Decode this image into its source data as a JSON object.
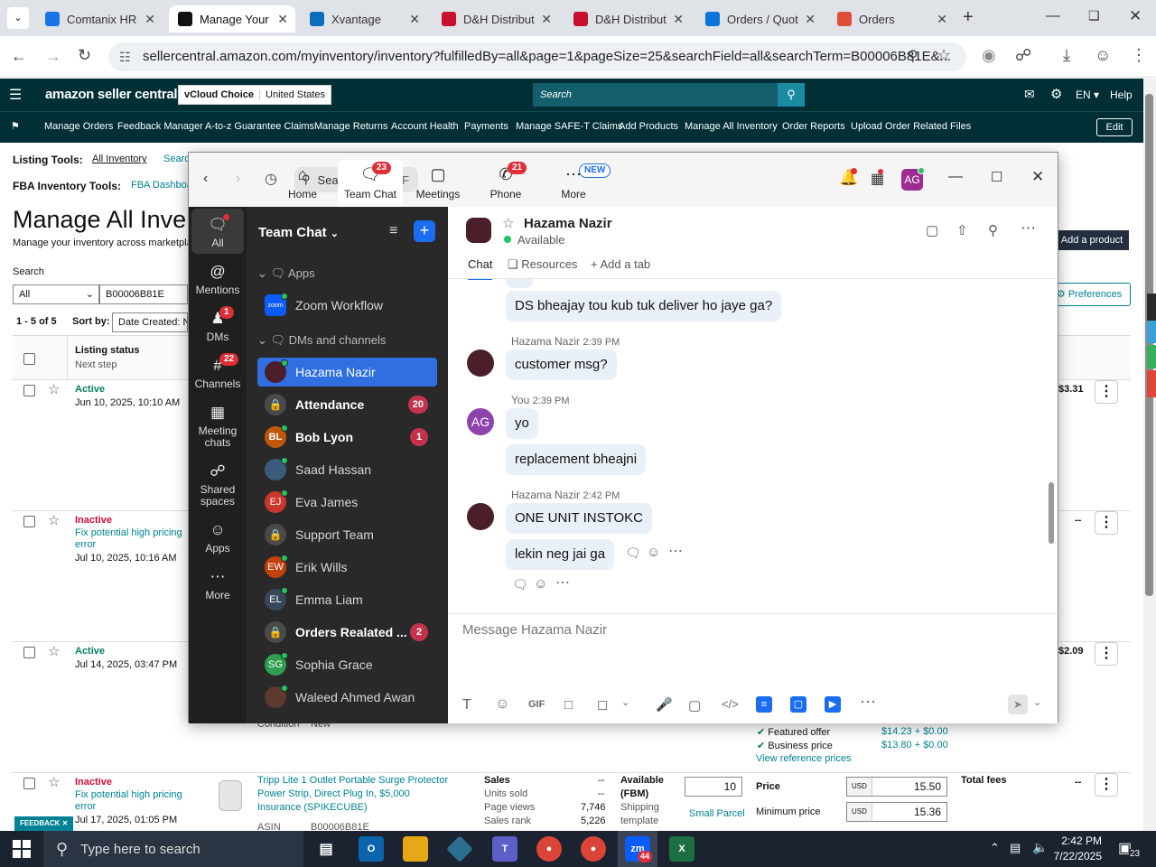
{
  "browser": {
    "tabs": [
      {
        "label": "Comtanix HR",
        "icon": "globe-icon",
        "color": "#1a73e8"
      },
      {
        "label": "Manage Your",
        "icon": "amazon-icon",
        "color": "#111111"
      },
      {
        "label": "Xvantage",
        "icon": "xvantage-icon",
        "color": "#0a6ebd"
      },
      {
        "label": "D&H Distribut",
        "icon": "dh-icon",
        "color": "#c8102e"
      },
      {
        "label": "D&H Distribut",
        "icon": "dh-icon",
        "color": "#c8102e"
      },
      {
        "label": "Orders / Quot",
        "icon": "ec-icon",
        "color": "#0a74da"
      },
      {
        "label": "Orders",
        "icon": "orders-icon",
        "color": "#e04e39"
      }
    ],
    "url": "sellercentral.amazon.com/myinventory/inventory?fulfilledBy=all&page=1&pageSize=25&searchField=all&searchTerm=B00006B81E&..."
  },
  "amazon": {
    "logo": "amazon seller central",
    "store": "vCloud Choice",
    "region": "United States",
    "search_placeholder": "Search",
    "lang": "EN",
    "help": "Help",
    "nav": [
      "Manage Orders",
      "Feedback Manager",
      "A-to-z Guarantee Claims",
      "Manage Returns",
      "Account Health",
      "Payments",
      "Manage SAFE-T Claims",
      "Add Products",
      "Manage All Inventory",
      "Order Reports",
      "Upload Order Related Files"
    ],
    "edit": "Edit",
    "listing_tools_label": "Listing Tools:",
    "all_inventory": "All Inventory",
    "searc": "Searc",
    "fba_label": "FBA Inventory Tools:",
    "fba_link": "FBA Dashboa",
    "page_title": "Manage All Inve",
    "subtitle": "Manage your inventory across marketpla",
    "search_label": "Search",
    "filter_all": "All",
    "search_value": "B00006B81E",
    "results": "1 - 5 of 5",
    "sort_by": "Sort by:",
    "sort_value": "Date Created: Ne",
    "add_product": "Add a product",
    "preferences": "Preferences",
    "col_status": "Listing status",
    "col_next": "Next step",
    "rows": [
      {
        "status": "Active",
        "kind": "active",
        "date": "Jun 10, 2025, 10:10 AM",
        "price": "$3.31"
      },
      {
        "status": "Inactive",
        "kind": "inactive",
        "fix": "Fix potential high pricing error",
        "date": "Jul 10, 2025, 10:16 AM",
        "price": "--"
      },
      {
        "status": "Active",
        "kind": "active",
        "date": "Jul 14, 2025, 03:47 PM",
        "price": "$2.09"
      },
      {
        "status": "Inactive",
        "kind": "inactive",
        "fix": "Fix potential high pricing error",
        "date": "Jul 17, 2025, 01:05 PM",
        "price": "--"
      }
    ],
    "row3_bottom": {
      "condition": "Condition",
      "condition_val": "New",
      "featured": "Featured offer",
      "featured_val": "$14.23 + $0.00",
      "business": "Business price",
      "business_val": "$13.80 + $0.00",
      "view_ref": "View reference prices"
    },
    "row4": {
      "title": "Tripp Lite 1 Outlet Portable Surge Protector Power Strip, Direct Plug In, $5,000 Insurance (SPIKECUBE)",
      "asin_label": "ASIN",
      "asin": "B00006B81E",
      "sales": "Sales",
      "units_sold": "Units sold",
      "units_val": "--",
      "page_views": "Page views",
      "page_views_val": "7,746",
      "sales_rank": "Sales rank",
      "sales_rank_val": "5,226",
      "sales_dash": "--",
      "available": "Available",
      "fbm": "(FBM)",
      "shipping": "Shipping",
      "template": "template",
      "qty": "10",
      "small_parcel": "Small Parcel",
      "price_label": "Price",
      "min_price_label": "Minimum price",
      "currency": "USD",
      "price": "15.50",
      "min_price": "15.36",
      "total_fees": "Total fees"
    },
    "feedback": "FEEDBACK"
  },
  "teams": {
    "search": "Search",
    "shortcut": "Ctrl+F",
    "topnav": [
      {
        "label": "Home",
        "icon": "home-icon"
      },
      {
        "label": "Team Chat",
        "icon": "chat-icon",
        "badge": "23"
      },
      {
        "label": "Meetings",
        "icon": "video-icon"
      },
      {
        "label": "Phone",
        "icon": "phone-icon",
        "badge": "21"
      },
      {
        "label": "More",
        "icon": "more-icon",
        "badge": "NEW"
      }
    ],
    "avatar": "AG",
    "rail": [
      {
        "label": "All",
        "icon": "chat-icon"
      },
      {
        "label": "Mentions",
        "icon": "at-icon"
      },
      {
        "label": "DMs",
        "icon": "people-icon",
        "badge": "1"
      },
      {
        "label": "Channels",
        "icon": "hash-icon",
        "badge": "22"
      },
      {
        "label": "Meeting chats",
        "icon": "calendar-icon"
      },
      {
        "label": "Shared spaces",
        "icon": "share-icon"
      },
      {
        "label": "Apps",
        "icon": "apps-icon"
      },
      {
        "label": "More",
        "icon": "dots-icon"
      }
    ],
    "list_title": "Team Chat",
    "apps_section": "Apps",
    "zoom_workflow": "Zoom Workflow",
    "dms_section": "DMs and channels",
    "contacts": [
      {
        "name": "Hazama Nazir",
        "initials": "",
        "color": "#4a1f2a",
        "sel": true
      },
      {
        "name": "Attendance",
        "initials": "",
        "color": "#4a4a4a",
        "lock": true,
        "count": "20",
        "bold": true
      },
      {
        "name": "Bob Lyon",
        "initials": "BL",
        "color": "#c2570c",
        "count": "1",
        "bold": true
      },
      {
        "name": "Saad Hassan",
        "initials": "",
        "color": "#3a5c7a"
      },
      {
        "name": "Eva James",
        "initials": "EJ",
        "color": "#c9372c"
      },
      {
        "name": "Support Team",
        "initials": "",
        "color": "#4a4a4a",
        "lock": true
      },
      {
        "name": "Erik Wills",
        "initials": "EW",
        "color": "#c2410c"
      },
      {
        "name": "Emma Liam",
        "initials": "EL",
        "color": "#37475a"
      },
      {
        "name": "Orders Realated ...",
        "initials": "",
        "color": "#4a4a4a",
        "lock": true,
        "count": "2",
        "bold": true
      },
      {
        "name": "Sophia Grace",
        "initials": "SG",
        "color": "#2e9e4f"
      },
      {
        "name": "Waleed Ahmed Awan",
        "initials": "",
        "color": "#5c3b2e"
      }
    ],
    "chat": {
      "name": "Hazama Nazir",
      "status": "Available",
      "tab_chat": "Chat",
      "tab_resources": "Resources",
      "add_tab": "Add a tab",
      "m1": "DS bheajay tou kub tuk deliver ho jaye ga?",
      "h1": "Hazama Nazir",
      "t1": "2:39 PM",
      "m2": "customer msg?",
      "you": "You",
      "t2": "2:39 PM",
      "m3": "yo",
      "m4": "replacement bheajni",
      "h2": "Hazama Nazir",
      "t3": "2:42 PM",
      "m5": "ONE UNIT INSTOKC",
      "m6": "lekin neg jai ga",
      "placeholder": "Message Hazama Nazir"
    }
  },
  "taskbar": {
    "search": "Type here to search",
    "time": "2:42 PM",
    "date": "7/22/2025",
    "notif": "23",
    "zoom_badge": "44"
  }
}
